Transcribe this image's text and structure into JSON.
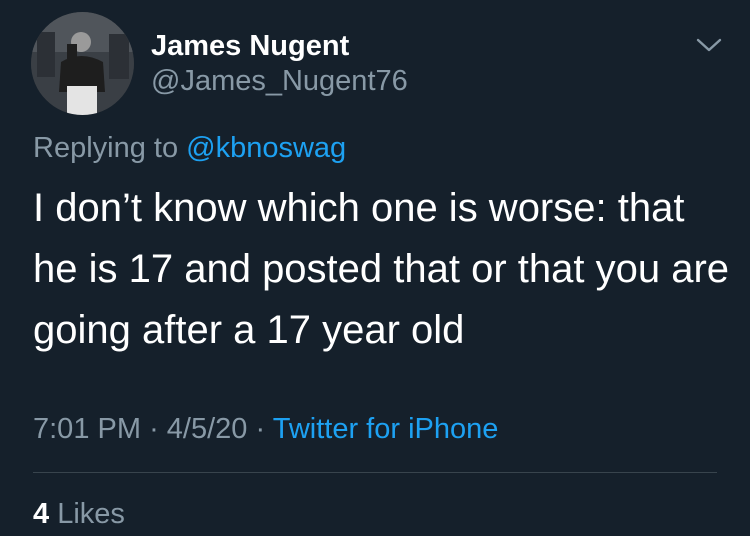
{
  "author": {
    "display_name": "James Nugent",
    "handle": "@James_Nugent76"
  },
  "reply": {
    "prefix": "Replying to",
    "mention": "@kbnoswag"
  },
  "tweet": {
    "text": "I don’t know which one is worse: that he is 17 and posted that or that you are going after a 17 year old"
  },
  "meta": {
    "time": "7:01 PM",
    "separator1": "·",
    "date": "4/5/20",
    "separator2": "·",
    "source": "Twitter for iPhone"
  },
  "stats": {
    "likes_count": "4",
    "likes_label": "Likes"
  },
  "icons": {
    "menu": "chevron-down-icon"
  },
  "colors": {
    "background": "#15202b",
    "accent": "#1da1f2",
    "secondary_text": "#8899a6",
    "divider": "#38444d"
  }
}
